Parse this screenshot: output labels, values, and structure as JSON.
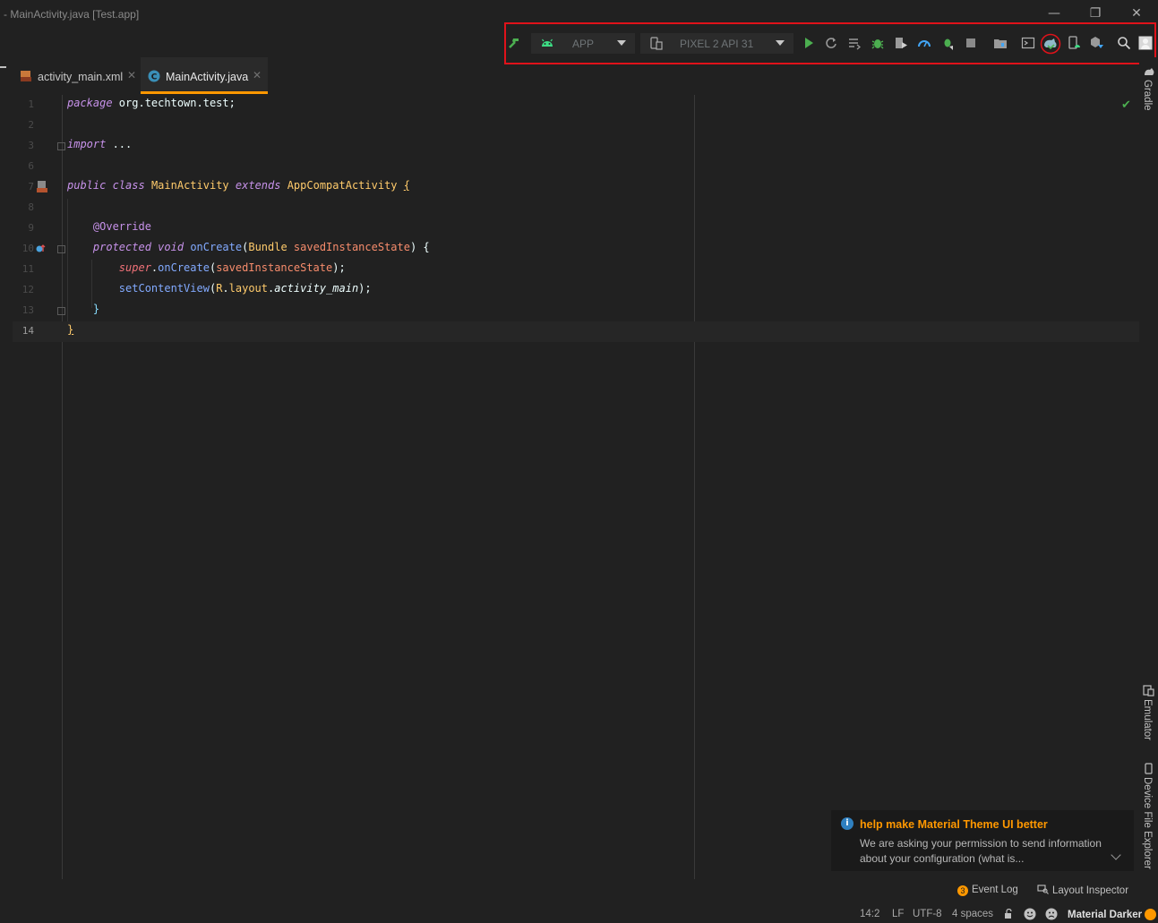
{
  "window": {
    "title": "- MainActivity.java [Test.app]",
    "controls": {
      "minimize": "—",
      "maximize": "❐",
      "close": "✕"
    }
  },
  "toolbar": {
    "config_combo": "APP",
    "device_combo": "PIXEL 2 API 31",
    "highlight_color": "#e0121a",
    "icons": [
      "make-project-icon",
      "android-icon",
      "device-icon",
      "run-icon",
      "apply-changes-icon",
      "apply-code-changes-icon",
      "debug-icon",
      "run-with-coverage-icon",
      "profile-icon",
      "attach-debugger-icon",
      "stop-icon",
      "project-structure-icon",
      "terminal-icon",
      "sync-gradle-icon",
      "device-manager-icon",
      "sdk-manager-icon",
      "search-icon",
      "account-icon"
    ]
  },
  "tabs": [
    {
      "label": "activity_main.xml",
      "close": "✕",
      "active": false
    },
    {
      "label": "MainActivity.java",
      "close": "✕",
      "active": true
    }
  ],
  "editor": {
    "line_numbers": [
      "1",
      "2",
      "3",
      "6",
      "7",
      "8",
      "9",
      "10",
      "11",
      "12",
      "13",
      "14"
    ],
    "lines": {
      "l1": {
        "kw": "package",
        "rest": " org.techtown.test;"
      },
      "l3": {
        "kw": "import",
        "rest": " ..."
      },
      "l7": {
        "kw1": "public",
        "kw2": "class",
        "cls": "MainActivity",
        "kw3": "extends",
        "parent": "AppCompatActivity",
        "brace": "{"
      },
      "l9": {
        "ann": "@Override"
      },
      "l10": {
        "kw1": "protected",
        "kw2": "void",
        "fn": "onCreate",
        "open": "(",
        "type": "Bundle",
        "param": " savedInstanceState",
        "close": ") {"
      },
      "l11": {
        "kw": "super",
        "dot": ".",
        "fn": "onCreate",
        "open": "(",
        "param": "savedInstanceState",
        "close": ");"
      },
      "l12": {
        "fn": "setContentView",
        "open": "(",
        "r": "R",
        "dot1": ".",
        "layout": "layout",
        "dot2": ".",
        "id": "activity_main",
        "close": ");"
      },
      "l13": {
        "brace": "}"
      },
      "l14": {
        "brace": "}"
      }
    }
  },
  "right_rail": {
    "gradle": "Gradle",
    "emulator": "Emulator",
    "device_file_explorer": "Device File Explorer"
  },
  "notification": {
    "title": "help make Material Theme UI better",
    "body": "We are asking your permission to send information about your configuration (what is..."
  },
  "bottom_bar": {
    "event_log_count": "3",
    "event_log": "Event Log",
    "layout_inspector": "Layout Inspector"
  },
  "status_bar": {
    "position": "14:2",
    "line_sep": "LF",
    "encoding": "UTF-8",
    "indent": "4 spaces",
    "theme": "Material Darker"
  }
}
